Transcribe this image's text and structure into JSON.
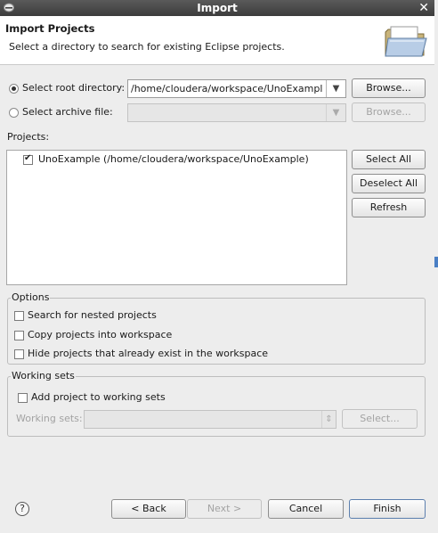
{
  "window": {
    "title": "Import"
  },
  "header": {
    "title": "Import Projects",
    "description": "Select a directory to search for existing Eclipse projects."
  },
  "source": {
    "root_dir_label": "Select root directory:",
    "root_dir_value": "/home/cloudera/workspace/UnoExample",
    "root_dir_selected": true,
    "archive_label": "Select archive file:",
    "archive_value": "",
    "archive_selected": false,
    "browse_label": "Browse...",
    "browse_archive_label": "Browse..."
  },
  "projects": {
    "label": "Projects:",
    "items": [
      {
        "label": "UnoExample (/home/cloudera/workspace/UnoExample)",
        "checked": true
      }
    ],
    "select_all": "Select All",
    "deselect_all": "Deselect All",
    "refresh": "Refresh"
  },
  "options": {
    "legend": "Options",
    "items": [
      {
        "label": "Search for nested projects",
        "checked": false
      },
      {
        "label": "Copy projects into workspace",
        "checked": false
      },
      {
        "label": "Hide projects that already exist in the workspace",
        "checked": false
      }
    ]
  },
  "working_sets": {
    "legend": "Working sets",
    "add_label": "Add project to working sets",
    "add_checked": false,
    "sets_label": "Working sets:",
    "sets_value": "",
    "select_label": "Select..."
  },
  "footer": {
    "help": "?",
    "back": "< Back",
    "next": "Next >",
    "cancel": "Cancel",
    "finish": "Finish"
  },
  "icons": {
    "window_menu": "window-menu-icon",
    "close": "close-icon",
    "header_image": "folder-import-icon",
    "help": "help-icon"
  }
}
